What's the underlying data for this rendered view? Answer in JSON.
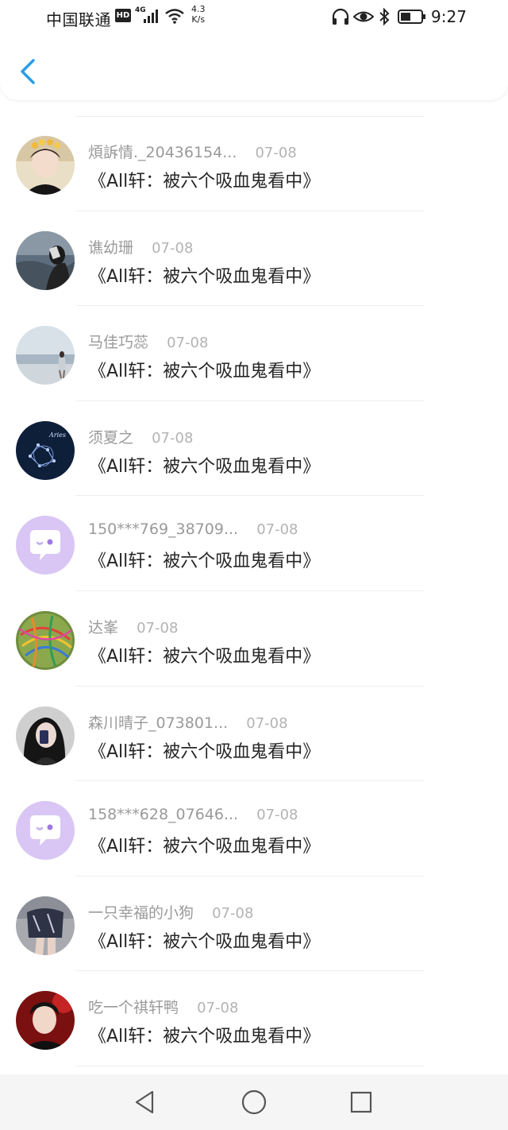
{
  "status_bar": {
    "carrier": "中国联通",
    "hd_badge": "HD",
    "network_type": "4G",
    "speed_value": "4.3",
    "speed_unit": "K/s",
    "time": "9:27",
    "icons": [
      "headphones-icon",
      "eye-icon",
      "bluetooth-icon",
      "battery-icon"
    ]
  },
  "header": {
    "back_icon": "chevron-left-icon",
    "accent_color": "#2a9ee6"
  },
  "items": [
    {
      "name": "煩訴情._20436154...",
      "date": "07-08",
      "title": "《All轩：被六个吸血鬼看中》",
      "avatar": "photo-boy-crown"
    },
    {
      "name": "谯幼珊",
      "date": "07-08",
      "title": "《All轩：被六个吸血鬼看中》",
      "avatar": "photo-girl-sea"
    },
    {
      "name": "马佳巧蕊",
      "date": "07-08",
      "title": "《All轩：被六个吸血鬼看中》",
      "avatar": "photo-beach"
    },
    {
      "name": "须夏之",
      "date": "07-08",
      "title": "《All轩：被六个吸血鬼看中》",
      "avatar": "constellation"
    },
    {
      "name": "150***769_38709...",
      "date": "07-08",
      "title": "《All轩：被六个吸血鬼看中》",
      "avatar": "default-chat-bubble"
    },
    {
      "name": "达峯",
      "date": "07-08",
      "title": "《All轩：被六个吸血鬼看中》",
      "avatar": "rubber-band-ball"
    },
    {
      "name": "森川晴子_073801...",
      "date": "07-08",
      "title": "《All轩：被六个吸血鬼看中》",
      "avatar": "photo-girl-phone"
    },
    {
      "name": "158***628_07646...",
      "date": "07-08",
      "title": "《All轩：被六个吸血鬼看中》",
      "avatar": "default-chat-bubble"
    },
    {
      "name": "一只幸福的小狗",
      "date": "07-08",
      "title": "《All轩：被六个吸血鬼看中》",
      "avatar": "photo-legs"
    },
    {
      "name": "吃一个祺轩鸭",
      "date": "07-08",
      "title": "《All轩：被六个吸血鬼看中》",
      "avatar": "photo-boy-red"
    }
  ],
  "nav_bar": {
    "buttons": [
      "back-triangle-icon",
      "home-circle-icon",
      "recents-square-icon"
    ]
  }
}
